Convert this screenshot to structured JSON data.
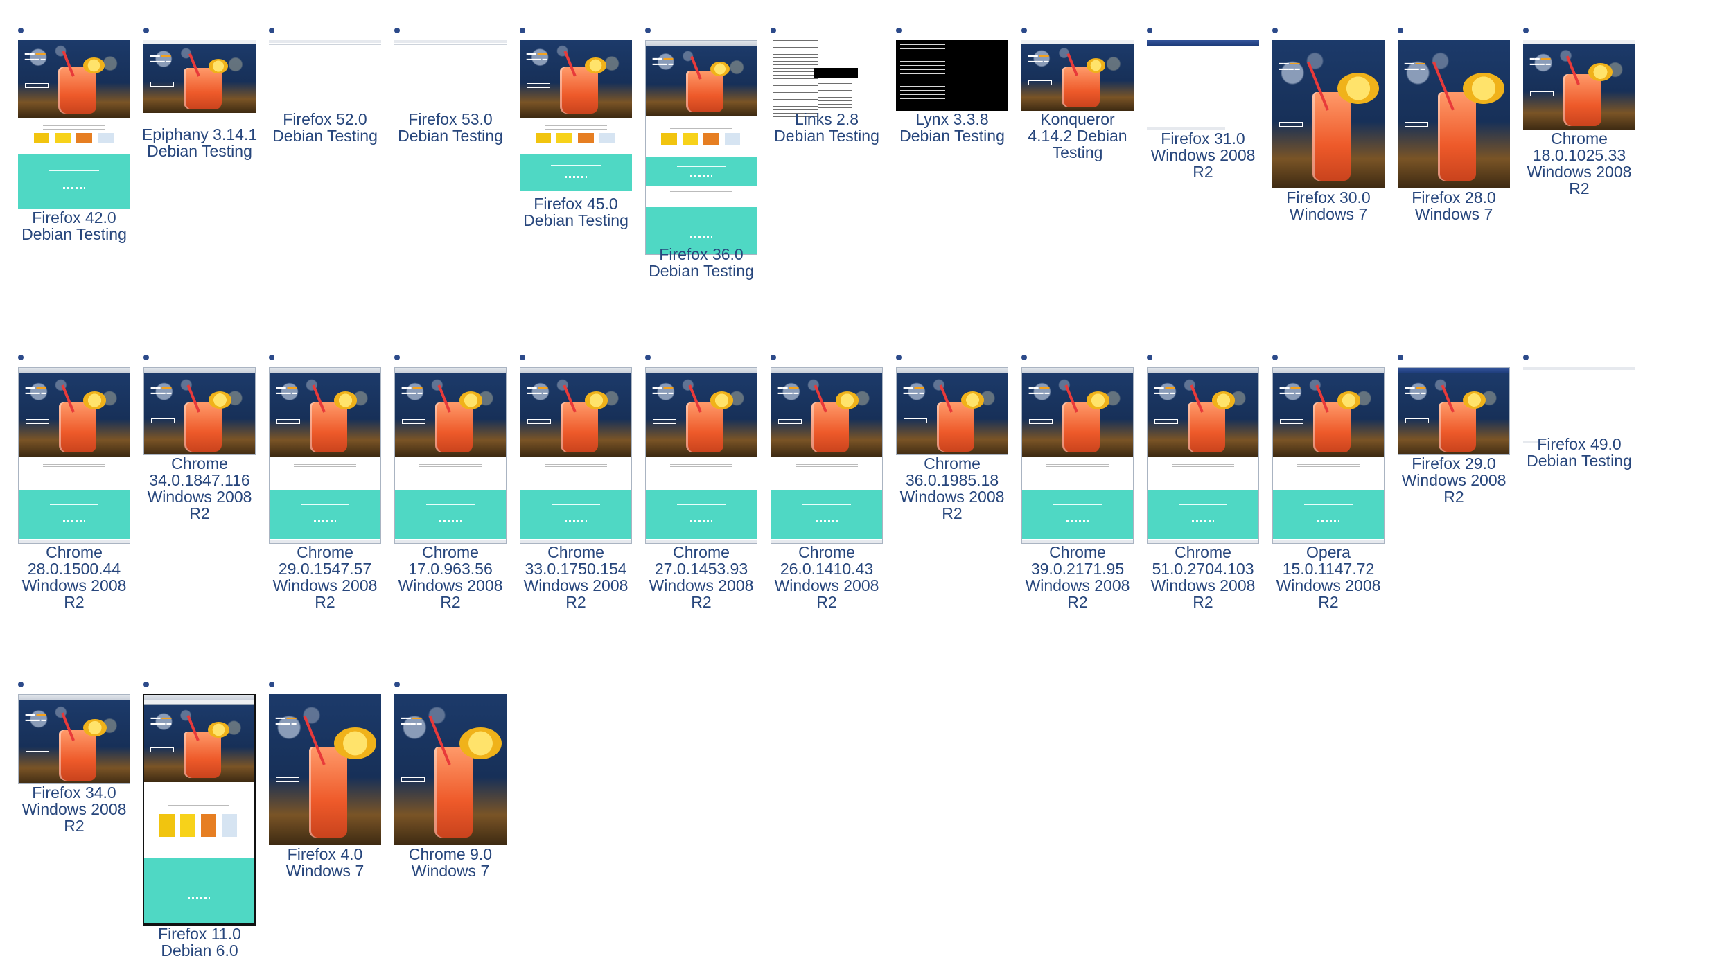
{
  "screenshots": [
    {
      "caption": "Firefox 42.0\nDebian Testing"
    },
    {
      "caption": "Epiphany 3.14.1\nDebian Testing"
    },
    {
      "caption": "Firefox 52.0\nDebian Testing"
    },
    {
      "caption": "Firefox 53.0\nDebian Testing"
    },
    {
      "caption": "Firefox 45.0\nDebian Testing"
    },
    {
      "caption": "Firefox 36.0\nDebian Testing"
    },
    {
      "caption": "Links 2.8\nDebian Testing"
    },
    {
      "caption": "Lynx 3.3.8\nDebian Testing"
    },
    {
      "caption": "Konqueror\n4.14.2 Debian\nTesting"
    },
    {
      "caption": "Firefox 31.0\nWindows 2008\nR2"
    },
    {
      "caption": "Firefox 30.0\nWindows 7"
    },
    {
      "caption": "Firefox 28.0\nWindows 7"
    },
    {
      "caption": "Chrome\n18.0.1025.33\nWindows 2008\nR2"
    },
    {
      "caption": "Chrome\n28.0.1500.44\nWindows 2008\nR2"
    },
    {
      "caption": "Chrome\n34.0.1847.116\nWindows 2008\nR2"
    },
    {
      "caption": "Chrome\n29.0.1547.57\nWindows 2008\nR2"
    },
    {
      "caption": "Chrome\n17.0.963.56\nWindows 2008\nR2"
    },
    {
      "caption": "Chrome\n33.0.1750.154\nWindows 2008\nR2"
    },
    {
      "caption": "Chrome\n27.0.1453.93\nWindows 2008\nR2"
    },
    {
      "caption": "Chrome\n26.0.1410.43\nWindows 2008\nR2"
    },
    {
      "caption": "Chrome\n36.0.1985.18\nWindows 2008\nR2"
    },
    {
      "caption": "Chrome\n39.0.2171.95\nWindows 2008\nR2"
    },
    {
      "caption": "Chrome\n51.0.2704.103\nWindows 2008\nR2"
    },
    {
      "caption": "Opera\n15.0.1147.72\nWindows 2008\nR2"
    },
    {
      "caption": "Firefox 29.0\nWindows 2008\nR2"
    },
    {
      "caption": "Firefox 49.0\nDebian Testing"
    },
    {
      "caption": "Firefox 34.0\nWindows 2008\nR2"
    },
    {
      "caption": "Firefox 11.0\nDebian 6.0"
    },
    {
      "caption": "Firefox 4.0\nWindows 7"
    },
    {
      "caption": "Chrome 9.0\nWindows 7"
    }
  ],
  "colors": {
    "caption": "#27467c",
    "bullet": "#2c4a8a",
    "teal": "#4fd8c4"
  }
}
